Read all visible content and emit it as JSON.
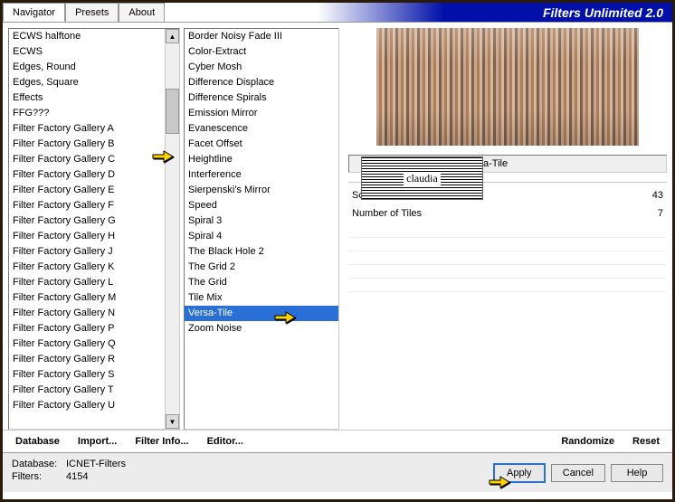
{
  "header": {
    "tabs": [
      "Navigator",
      "Presets",
      "About"
    ],
    "title": "Filters Unlimited 2.0"
  },
  "category_list": [
    "ECWS halftone",
    "ECWS",
    "Edges, Round",
    "Edges, Square",
    "Effects",
    "FFG???",
    "Filter Factory Gallery A",
    "Filter Factory Gallery B",
    "Filter Factory Gallery C",
    "Filter Factory Gallery D",
    "Filter Factory Gallery E",
    "Filter Factory Gallery F",
    "Filter Factory Gallery G",
    "Filter Factory Gallery H",
    "Filter Factory Gallery J",
    "Filter Factory Gallery K",
    "Filter Factory Gallery L",
    "Filter Factory Gallery M",
    "Filter Factory Gallery N",
    "Filter Factory Gallery P",
    "Filter Factory Gallery Q",
    "Filter Factory Gallery R",
    "Filter Factory Gallery S",
    "Filter Factory Gallery T",
    "Filter Factory Gallery U"
  ],
  "category_selected_index": 8,
  "filter_list": [
    "Border Noisy Fade III",
    "Color-Extract",
    "Cyber Mosh",
    "Difference Displace",
    "Difference Spirals",
    "Emission Mirror",
    "Evanescence",
    "Facet Offset",
    "Heightline",
    "Interference",
    "Sierpenski's Mirror",
    "Speed",
    "Spiral 3",
    "Spiral 4",
    "The Black Hole 2",
    "The Grid 2",
    "The Grid",
    "Tile Mix",
    "Versa-Tile",
    "Zoom Noise"
  ],
  "filter_selected_index": 18,
  "current_filter_name": "Versa-Tile",
  "watermark": "claudia",
  "params": [
    {
      "label": "Scale",
      "value": "43"
    },
    {
      "label": "Number of Tiles",
      "value": "7"
    }
  ],
  "toolbar": {
    "database": "Database",
    "import": "Import...",
    "filter_info": "Filter Info...",
    "editor": "Editor...",
    "randomize": "Randomize",
    "reset": "Reset"
  },
  "status": {
    "database_label": "Database:",
    "database_value": "ICNET-Filters",
    "filters_label": "Filters:",
    "filters_value": "4154"
  },
  "buttons": {
    "apply": "Apply",
    "cancel": "Cancel",
    "help": "Help"
  }
}
